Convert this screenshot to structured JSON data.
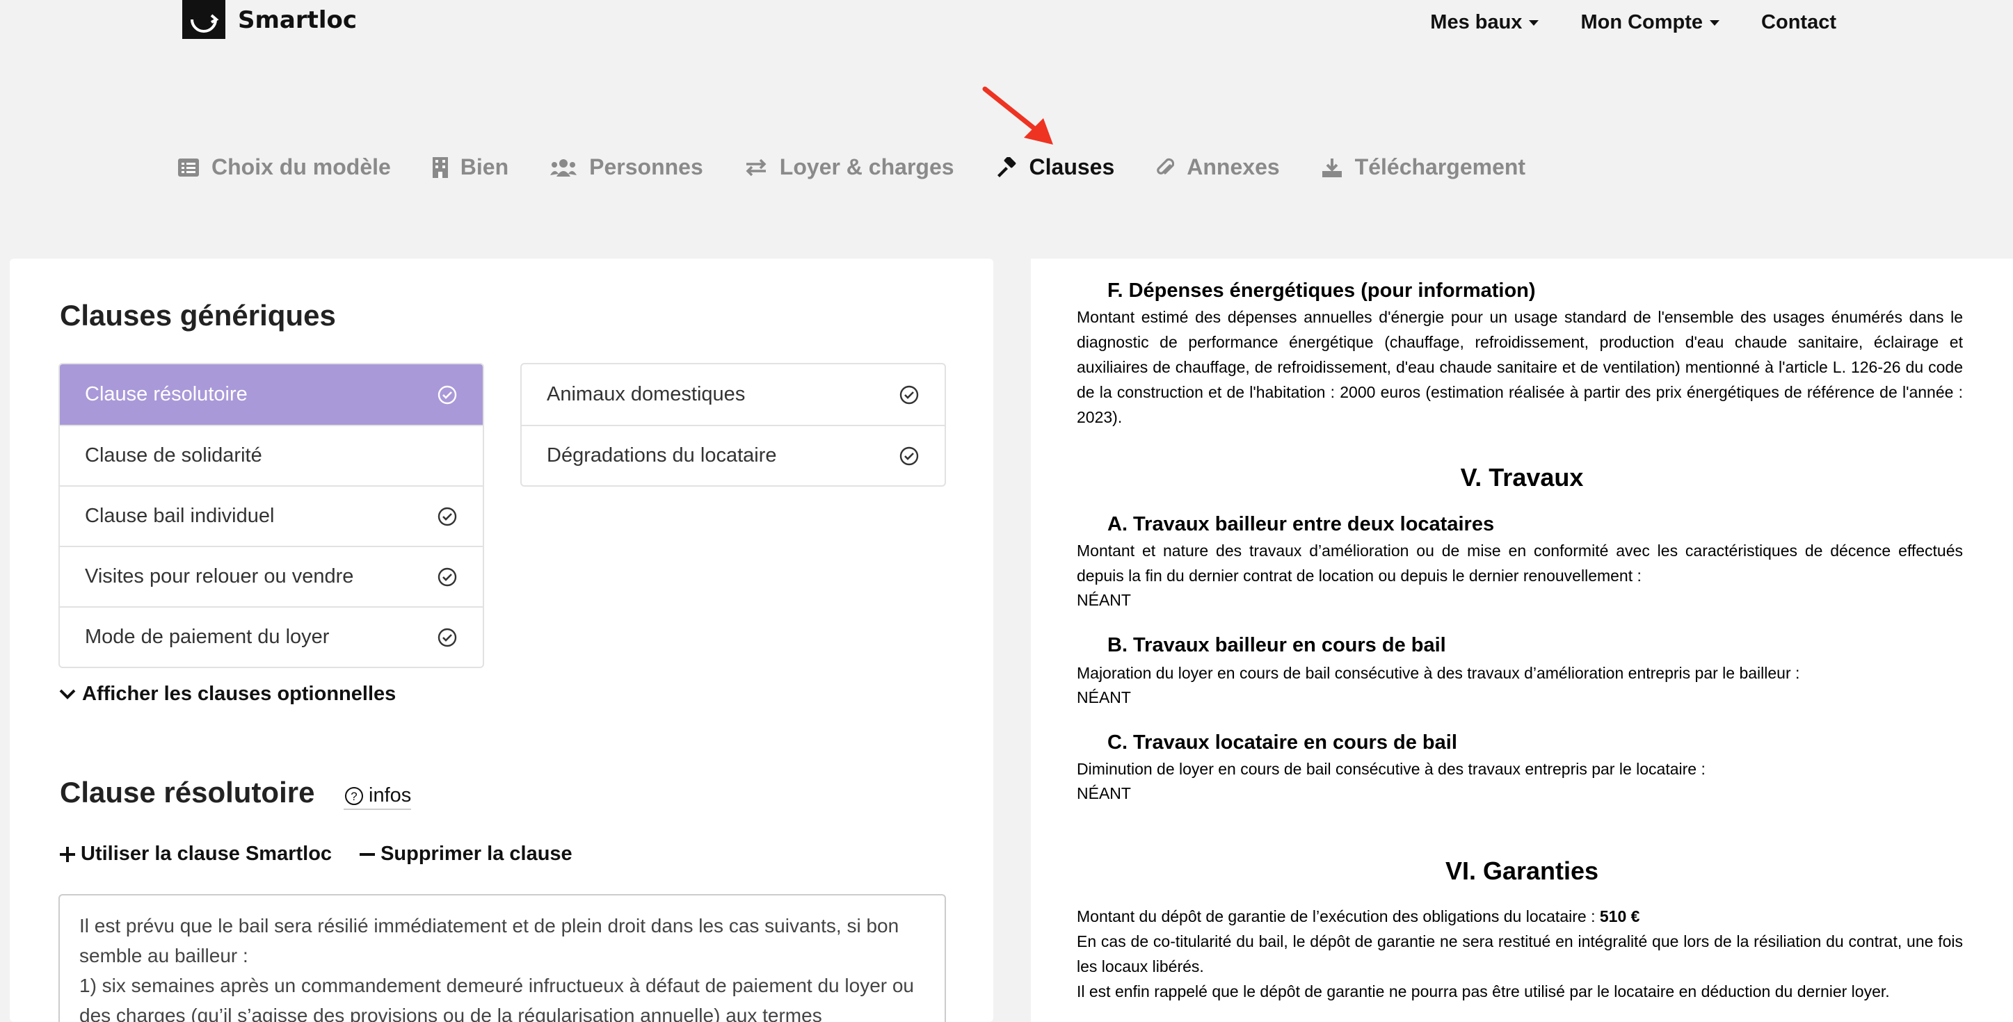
{
  "brand": {
    "name": "Smartloc"
  },
  "nav": {
    "mes_baux": "Mes baux",
    "mon_compte": "Mon Compte",
    "contact": "Contact"
  },
  "steps": [
    {
      "label": "Choix du modèle",
      "icon": "list-icon",
      "active": false
    },
    {
      "label": "Bien",
      "icon": "building-icon",
      "active": false
    },
    {
      "label": "Personnes",
      "icon": "users-icon",
      "active": false
    },
    {
      "label": "Loyer & charges",
      "icon": "exchange-icon",
      "active": false
    },
    {
      "label": "Clauses",
      "icon": "gavel-icon",
      "active": true
    },
    {
      "label": "Annexes",
      "icon": "paperclip-icon",
      "active": false
    },
    {
      "label": "Téléchargement",
      "icon": "download-icon",
      "active": false
    }
  ],
  "left": {
    "title": "Clauses génériques",
    "clauses_left": [
      {
        "label": "Clause résolutoire",
        "checked": true,
        "active": true
      },
      {
        "label": "Clause de solidarité",
        "checked": false,
        "active": false
      },
      {
        "label": "Clause bail individuel",
        "checked": true,
        "active": false
      },
      {
        "label": "Visites pour relouer ou vendre",
        "checked": true,
        "active": false
      },
      {
        "label": "Mode de paiement du loyer",
        "checked": true,
        "active": false
      }
    ],
    "clauses_right": [
      {
        "label": "Animaux domestiques",
        "checked": true
      },
      {
        "label": "Dégradations du locataire",
        "checked": true
      }
    ],
    "toggle_optional": "Afficher les clauses optionnelles",
    "clause_title": "Clause résolutoire",
    "infos": "infos",
    "use_smartloc": "Utiliser la clause Smartloc",
    "delete_clause": "Supprimer la clause",
    "clause_text_1": "Il est prévu que le bail sera résilié immédiatement et de plein droit dans les cas suivants, si bon semble au bailleur :",
    "clause_text_2": "1) six semaines après un commandement demeuré infructueux à défaut de paiement du loyer ou des charges (qu’il s’agisse des provisions ou de la régularisation annuelle) aux termes"
  },
  "doc": {
    "f_title": "F.  Dépenses énergétiques (pour information)",
    "f_text": "Montant estimé des dépenses annuelles d'énergie pour un usage standard de l'ensemble des usages énumérés dans le diagnostic de performance énergétique (chauffage, refroidissement, production d'eau chaude sanitaire, éclairage et auxiliaires de chauffage, de refroidissement, d'eau chaude sanitaire et de ventilation) mentionné à l'article L. 126-26 du code de la construction et de l'habitation : 2000 euros (estimation réalisée à partir des prix énergétiques de référence de l'année : 2023).",
    "v_title": "V.   Travaux",
    "a_title": "A.  Travaux bailleur entre deux locataires",
    "a_text": "Montant et nature des travaux d’amélioration ou de mise en conformité avec les caractéristiques de décence effectués depuis la fin du dernier contrat de location ou depuis le dernier renouvellement :",
    "a_value": "NÉANT",
    "b_title": "B.  Travaux bailleur en cours de bail",
    "b_text": "Majoration du loyer en cours de bail consécutive à des travaux d’amélioration entrepris par le bailleur :",
    "b_value": "NÉANT",
    "c_title": "C.  Travaux locataire en cours de bail",
    "c_text": "Diminution de loyer en cours de bail consécutive à des travaux entrepris par le locataire :",
    "c_value": "NÉANT",
    "vi_title": "VI.   Garanties",
    "g_text_1": "Montant du dépôt de garantie de l’exécution des obligations du locataire : ",
    "g_amount": "510 €",
    "g_text_2": "En cas de co-titularité du bail, le dépôt de garantie ne sera restitué en intégralité que lors de la résiliation du contrat, une fois les locaux libérés.",
    "g_text_3": "Il est enfin rappelé que le dépôt de garantie ne pourra pas être utilisé par le locataire en déduction du dernier loyer."
  },
  "colors": {
    "active_item": "#a999d8",
    "arrow": "#ee3322",
    "background": "#f2f2f2"
  }
}
